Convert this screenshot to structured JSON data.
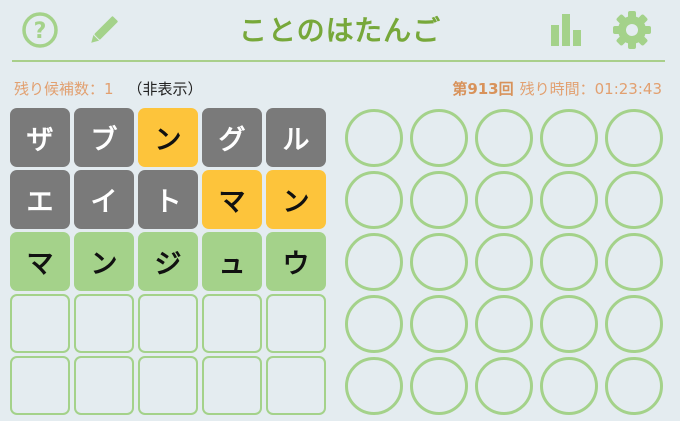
{
  "header": {
    "title": "ことのはたんご",
    "icons": [
      "help-icon",
      "edit-icon",
      "stats-icon",
      "gear-icon"
    ],
    "accent": "#77a83a"
  },
  "info": {
    "remaining_label": "残り候補数：1",
    "hidden_label": "（非表示）",
    "round": "第913回",
    "time_label": "残り時間：01:23:43"
  },
  "colors": {
    "gray": "#7a7a7a",
    "yellow": "#fdc43b",
    "green": "#a4d28a",
    "empty_border": "#a4d28a"
  },
  "board": {
    "rows": [
      [
        {
          "ch": "ザ",
          "state": "gray"
        },
        {
          "ch": "ブ",
          "state": "gray"
        },
        {
          "ch": "ン",
          "state": "yellow"
        },
        {
          "ch": "グ",
          "state": "gray"
        },
        {
          "ch": "ル",
          "state": "gray"
        }
      ],
      [
        {
          "ch": "エ",
          "state": "gray"
        },
        {
          "ch": "イ",
          "state": "gray"
        },
        {
          "ch": "ト",
          "state": "gray"
        },
        {
          "ch": "マ",
          "state": "yellow"
        },
        {
          "ch": "ン",
          "state": "yellow"
        }
      ],
      [
        {
          "ch": "マ",
          "state": "green"
        },
        {
          "ch": "ン",
          "state": "green"
        },
        {
          "ch": "ジ",
          "state": "green"
        },
        {
          "ch": "ュ",
          "state": "green"
        },
        {
          "ch": "ウ",
          "state": "green"
        }
      ],
      [
        {
          "ch": "",
          "state": "empty"
        },
        {
          "ch": "",
          "state": "empty"
        },
        {
          "ch": "",
          "state": "empty"
        },
        {
          "ch": "",
          "state": "empty"
        },
        {
          "ch": "",
          "state": "empty"
        }
      ],
      [
        {
          "ch": "",
          "state": "empty"
        },
        {
          "ch": "",
          "state": "empty"
        },
        {
          "ch": "",
          "state": "empty"
        },
        {
          "ch": "",
          "state": "empty"
        },
        {
          "ch": "",
          "state": "empty"
        }
      ]
    ]
  },
  "circle_grid": {
    "rows": 5,
    "cols": 5
  }
}
